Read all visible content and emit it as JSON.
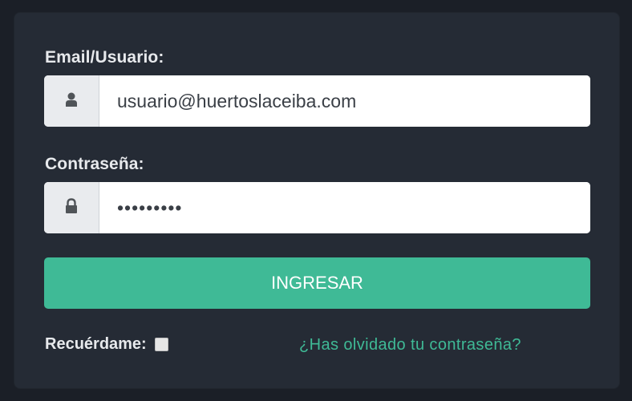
{
  "login": {
    "email_label": "Email/Usuario:",
    "email_value": "usuario@huertoslaceiba.com",
    "password_label": "Contraseña:",
    "password_value": "•••••••••",
    "submit_label": "INGRESAR",
    "remember_label": "Recuérdame:",
    "remember_checked": false,
    "forgot_link": "¿Has olvidado tu contraseña?"
  },
  "icons": {
    "email_addon": "user-icon",
    "password_addon": "lock-icon"
  },
  "colors": {
    "page_background": "#1b1f27",
    "panel_background": "#252b35",
    "accent": "#3fba96",
    "label_text": "#e7e9ec",
    "addon_background": "#e9ebee"
  }
}
